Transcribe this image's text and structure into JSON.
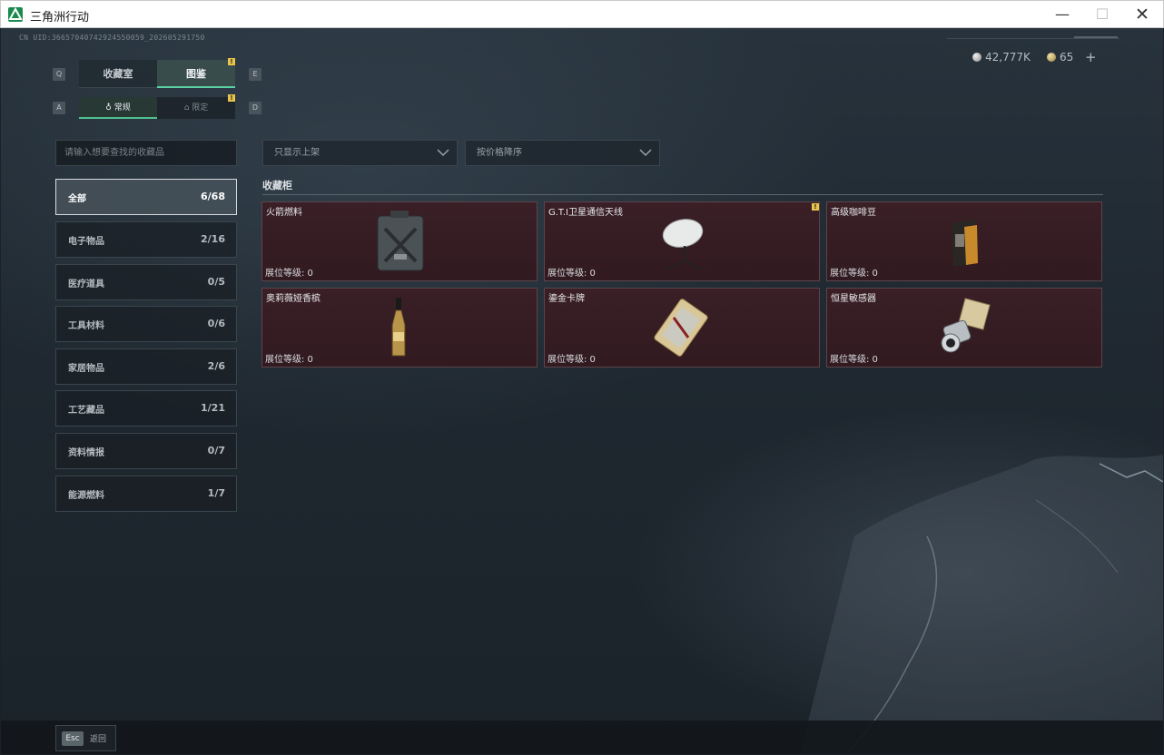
{
  "window": {
    "title": "三角洲行动",
    "min_glyph": "—",
    "max_glyph": "☐",
    "close_glyph": "✕"
  },
  "uid": "CN UID:3665704074292455005​9_202605291750",
  "currency": {
    "silver": "42,777K",
    "gold": "65",
    "plus": "+"
  },
  "keys": {
    "tab_left": "Q",
    "tab_right": "E",
    "sub_left": "A",
    "sub_right": "D"
  },
  "tabs": [
    {
      "label": "收藏室",
      "active": false
    },
    {
      "label": "图鉴",
      "active": true
    }
  ],
  "subtabs": [
    {
      "label": "常规",
      "active": true
    },
    {
      "label": "限定",
      "active": false
    }
  ],
  "badge_glyph": "!",
  "search": {
    "placeholder": "请输入想要查找的收藏品"
  },
  "filters": [
    {
      "label": "只显示上架"
    },
    {
      "label": "按价格降序"
    }
  ],
  "categories": [
    {
      "label": "全部",
      "count": "6/68",
      "active": true
    },
    {
      "label": "电子物品",
      "count": "2/16"
    },
    {
      "label": "医疗道具",
      "count": "0/5"
    },
    {
      "label": "工具材料",
      "count": "0/6"
    },
    {
      "label": "家居物品",
      "count": "2/6"
    },
    {
      "label": "工艺藏品",
      "count": "1/21"
    },
    {
      "label": "资料情报",
      "count": "0/7"
    },
    {
      "label": "能源燃料",
      "count": "1/7"
    }
  ],
  "section": {
    "title": "收藏柜"
  },
  "items": [
    {
      "name": "火箭燃料",
      "level": "展位等级:  0",
      "icon": "fuel-canister-icon"
    },
    {
      "name": "G.T.I卫星通信天线",
      "level": "展位等级:  0",
      "icon": "satellite-dish-icon"
    },
    {
      "name": "高级咖啡豆",
      "level": "展位等级:  0",
      "icon": "coffee-bag-icon"
    },
    {
      "name": "奥莉薇娅香槟",
      "level": "展位等级:  0",
      "icon": "champagne-bottle-icon"
    },
    {
      "name": "鎏金卡牌",
      "level": "展位等级:  0",
      "icon": "gilded-card-icon"
    },
    {
      "name": "恒星敏感器",
      "level": "展位等级:  0",
      "icon": "star-sensor-icon"
    }
  ],
  "bottom": {
    "esc_key": "Esc",
    "esc_label": "返回"
  },
  "colors": {
    "accent": "#5ad1a0",
    "card_bg": "#3a1f26",
    "badge": "#e8c54a"
  }
}
